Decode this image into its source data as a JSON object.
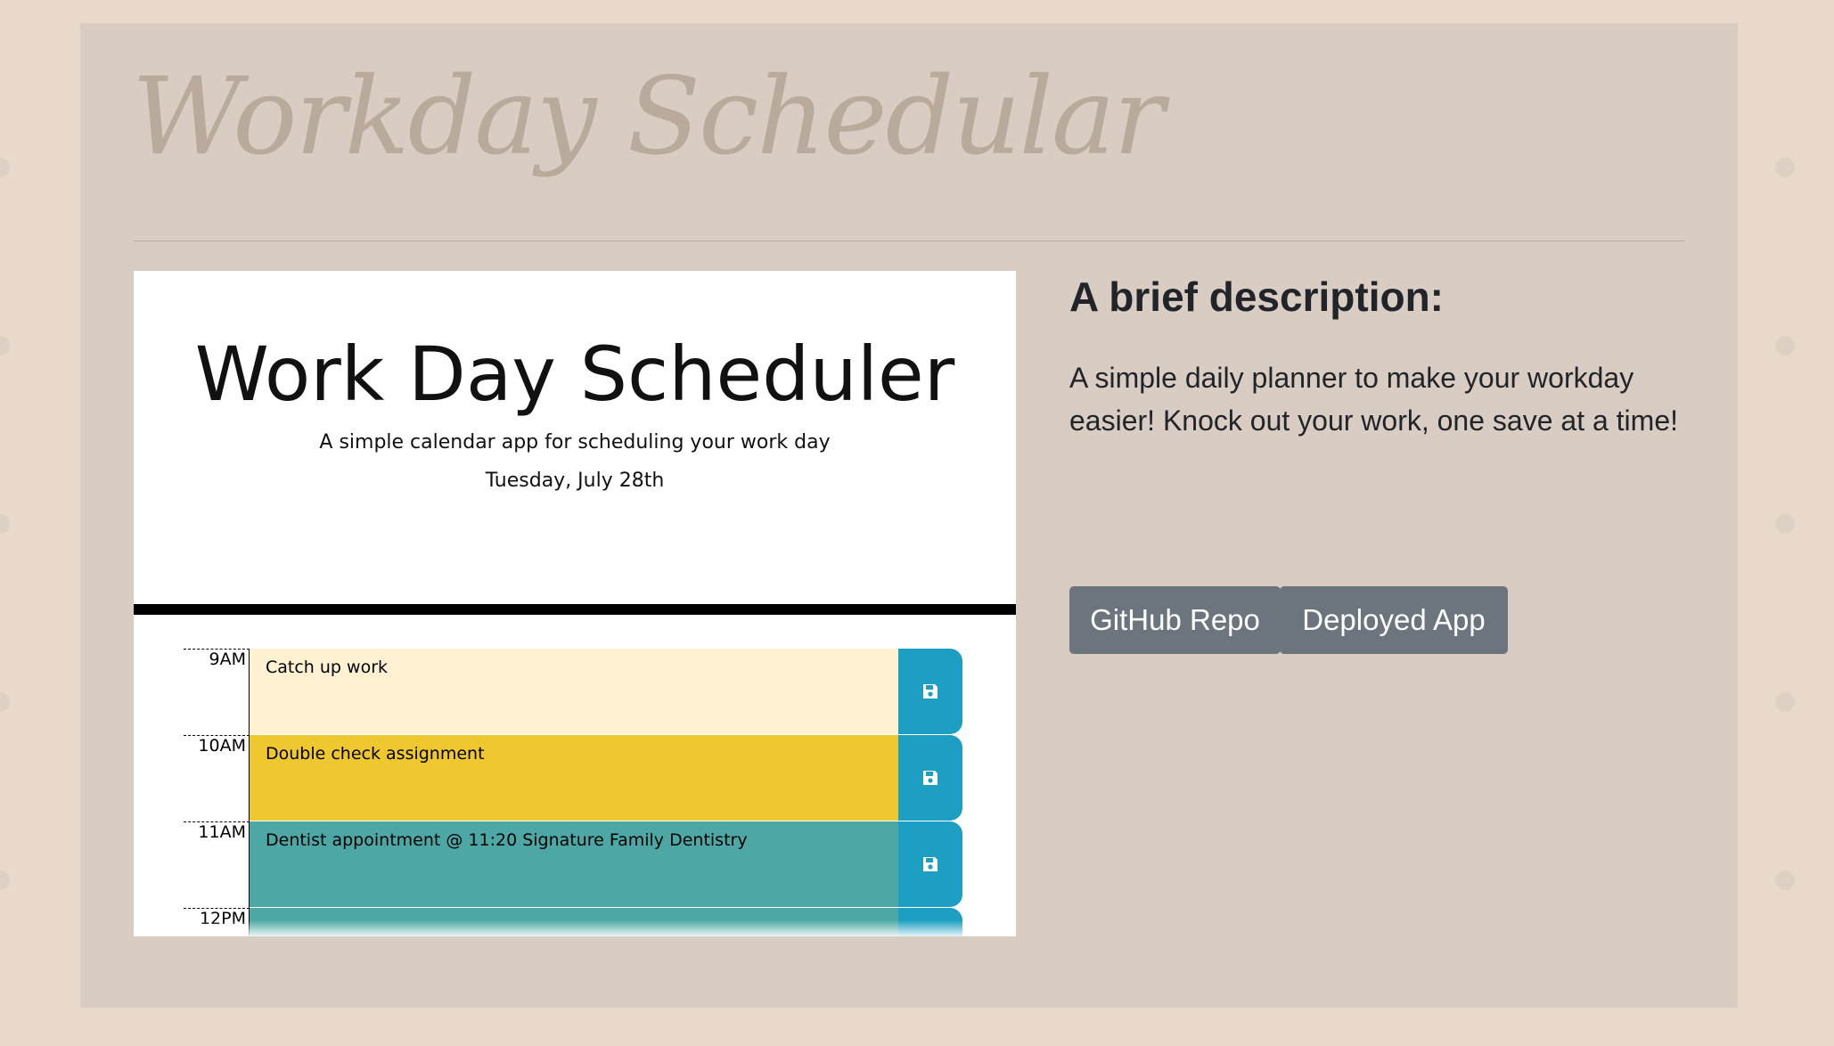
{
  "brand_title": "Workday Schedular",
  "preview": {
    "title": "Work Day Scheduler",
    "subtitle": "A simple calendar app for scheduling your work day",
    "date": "Tuesday, July 28th",
    "rows": [
      {
        "hour": "9AM",
        "task": "Catch up work",
        "status": "future",
        "color": "#fff1d2"
      },
      {
        "hour": "10AM",
        "task": "Double check assignment",
        "status": "present",
        "color": "#efc82f"
      },
      {
        "hour": "11AM",
        "task": "Dentist appointment @ 11:20 Signature Family Dentistry",
        "status": "past",
        "color": "#4da8a5"
      },
      {
        "hour": "12PM",
        "task": "",
        "status": "past",
        "color": "#4da8a5"
      }
    ],
    "save_icon": "save-icon",
    "save_color": "#1c9fc2"
  },
  "description": {
    "heading": "A brief description:",
    "text": "A simple daily planner to make your workday easier! Knock out your work, one save at a time!"
  },
  "buttons": {
    "github": "GitHub Repo",
    "deployed": "Deployed App"
  },
  "colors": {
    "page_bg": "#e8d9ca",
    "card_bg": "#d8ccc3",
    "button_bg": "#6c757d"
  }
}
